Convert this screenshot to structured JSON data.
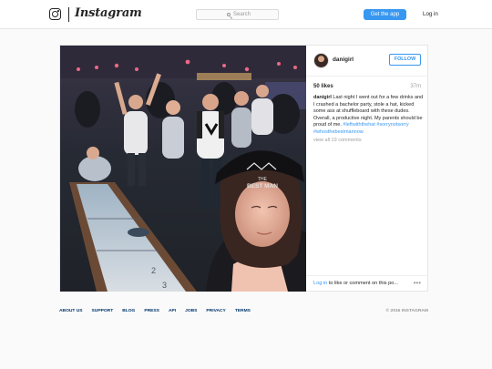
{
  "header": {
    "logo_text": "Instagram",
    "search_placeholder": "Search",
    "get_app_label": "Get the app",
    "login_label": "Log in"
  },
  "post": {
    "username": "danigirl",
    "follow_label": "FOLLOW",
    "likes": "50 likes",
    "time_ago": "37m",
    "caption_user": "danigirl",
    "caption_text": "Last night I went out for a few drinks and I crashed a bachelor party, stole a hat, kicked some ass at shuffleboard with these dudes. Overall, a productive night. My parents should be proud of me.",
    "hashtags": "#leftwiththehat #sorrynotsorry #whosthebestmannow",
    "view_all": "view all 19 comments",
    "login_link": "Log in",
    "login_rest": "to like or comment on this po...",
    "more_icon": "more-options-icon",
    "hat_text_1": "THE",
    "hat_text_2": "BEST MAN"
  },
  "footer": {
    "links": [
      "ABOUT US",
      "SUPPORT",
      "BLOG",
      "PRESS",
      "API",
      "JOBS",
      "PRIVACY",
      "TERMS"
    ],
    "copyright": "© 2016 INSTAGRAM"
  },
  "colors": {
    "accent": "#3897f0",
    "footer_link": "#003569"
  }
}
